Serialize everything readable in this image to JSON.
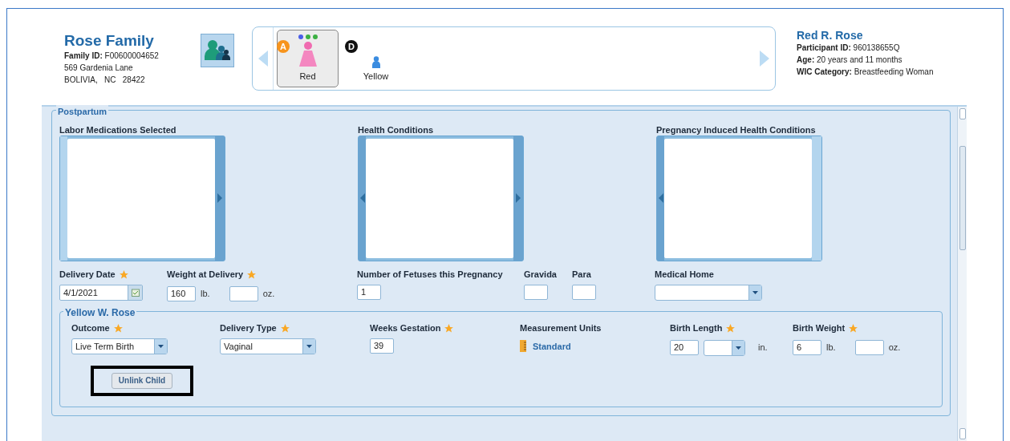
{
  "family": {
    "name": "Rose Family",
    "id_label": "Family ID:",
    "id": "F00600004652",
    "address": "569 Gardenia Lane",
    "city": "BOLIVIA,",
    "state": "NC",
    "zip": "28422"
  },
  "members": [
    {
      "name": "Red",
      "kind": "woman",
      "selected": true,
      "badge": {
        "letter": "A",
        "color": "#f7941d"
      },
      "dots": [
        {
          "color": "#4a5ee8"
        },
        {
          "color": "#3cb043"
        },
        {
          "color": "#3cb043"
        }
      ]
    },
    {
      "name": "Yellow",
      "kind": "child",
      "selected": false,
      "badge": {
        "letter": "D",
        "color": "#111111"
      }
    }
  ],
  "participant": {
    "name": "Red R. Rose",
    "id_label": "Participant ID:",
    "id": "960138655Q",
    "age_label": "Age:",
    "age": "20 years and 11 months",
    "category_label": "WIC Category:",
    "category": "Breastfeeding Woman"
  },
  "postpartum": {
    "title": "Postpartum",
    "lists": [
      {
        "label": "Labor Medications Selected",
        "left_arrow": false,
        "right_arrow": true
      },
      {
        "label": "Health Conditions",
        "left_arrow": true,
        "right_arrow": true
      },
      {
        "label": "Pregnancy Induced Health Conditions",
        "left_arrow": true,
        "right_arrow": false
      }
    ],
    "fields": [
      {
        "kind": "date",
        "label": "Delivery Date",
        "required": true,
        "value": "4/1/2021"
      },
      {
        "kind": "weight",
        "label": "Weight at Delivery",
        "required": true,
        "pounds": "160",
        "pound_unit": "lb.",
        "ounce_unit": "oz."
      },
      {
        "kind": "text",
        "label": "Number of Fetuses this Pregnancy",
        "required": false,
        "value": "1"
      },
      {
        "kind": "text",
        "label": "Gravida",
        "required": false
      },
      {
        "kind": "text",
        "label": "Para",
        "required": false
      },
      {
        "kind": "select",
        "label": "Medical Home",
        "required": false
      }
    ],
    "child": {
      "title": "Yellow W. Rose",
      "fields": [
        {
          "kind": "select",
          "label": "Outcome",
          "required": true,
          "value": "Live Term Birth"
        },
        {
          "kind": "select",
          "label": "Delivery Type",
          "required": true,
          "value": "Vaginal"
        },
        {
          "kind": "text",
          "label": "Weeks Gestation",
          "required": true,
          "value": "39"
        },
        {
          "kind": "units",
          "label": "Measurement Units",
          "required": false,
          "value": "Standard"
        },
        {
          "kind": "length",
          "label": "Birth Length",
          "required": true,
          "value": "20",
          "unit": "in."
        },
        {
          "kind": "weight",
          "label": "Birth Weight",
          "required": true,
          "pounds": "6",
          "pound_unit": "lb.",
          "ounce_unit": "oz."
        }
      ],
      "button": {
        "label": "Unlink Child",
        "highlighted": true
      }
    }
  }
}
